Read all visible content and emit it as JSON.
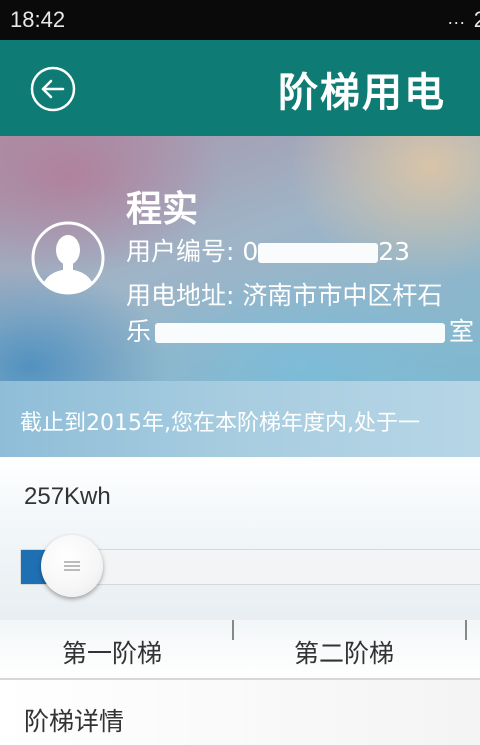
{
  "status_bar": {
    "time": "18:42",
    "dots": "...",
    "signal": "2"
  },
  "header": {
    "title": "阶梯用电"
  },
  "profile": {
    "name": "程实",
    "number_label": "用户编号: ",
    "number_prefix": "0",
    "number_suffix": "23",
    "address_label": "用电地址: ",
    "address_line1": "济南市市中区杆石",
    "address_line2_start": "乐",
    "address_line2_end": "室"
  },
  "notice": {
    "text": "截止到2015年,您在本阶梯年度内,处于一"
  },
  "usage": {
    "value": "257Kwh",
    "slider_fraction": 0.05
  },
  "tiers": [
    "第一阶梯",
    "第二阶梯"
  ],
  "detail": {
    "label": "阶梯详情"
  },
  "colors": {
    "header": "#0e7c74",
    "slider_fill": "#1f6fb3",
    "status_bar": "#0a0a0a"
  }
}
